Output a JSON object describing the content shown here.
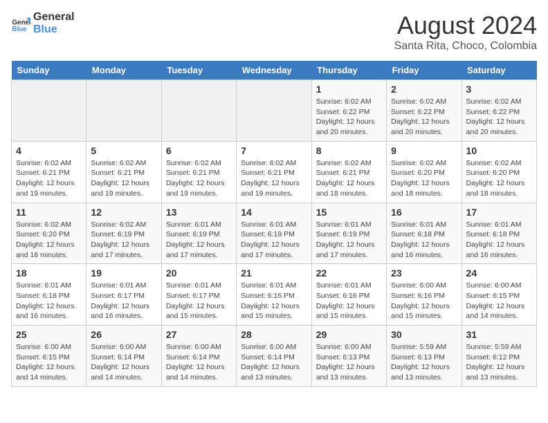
{
  "logo": {
    "line1": "General",
    "line2": "Blue"
  },
  "title": "August 2024",
  "subtitle": "Santa Rita, Choco, Colombia",
  "days_of_week": [
    "Sunday",
    "Monday",
    "Tuesday",
    "Wednesday",
    "Thursday",
    "Friday",
    "Saturday"
  ],
  "weeks": [
    [
      {
        "day": "",
        "info": ""
      },
      {
        "day": "",
        "info": ""
      },
      {
        "day": "",
        "info": ""
      },
      {
        "day": "",
        "info": ""
      },
      {
        "day": "1",
        "info": "Sunrise: 6:02 AM\nSunset: 6:22 PM\nDaylight: 12 hours and 20 minutes."
      },
      {
        "day": "2",
        "info": "Sunrise: 6:02 AM\nSunset: 6:22 PM\nDaylight: 12 hours and 20 minutes."
      },
      {
        "day": "3",
        "info": "Sunrise: 6:02 AM\nSunset: 6:22 PM\nDaylight: 12 hours and 20 minutes."
      }
    ],
    [
      {
        "day": "4",
        "info": "Sunrise: 6:02 AM\nSunset: 6:21 PM\nDaylight: 12 hours and 19 minutes."
      },
      {
        "day": "5",
        "info": "Sunrise: 6:02 AM\nSunset: 6:21 PM\nDaylight: 12 hours and 19 minutes."
      },
      {
        "day": "6",
        "info": "Sunrise: 6:02 AM\nSunset: 6:21 PM\nDaylight: 12 hours and 19 minutes."
      },
      {
        "day": "7",
        "info": "Sunrise: 6:02 AM\nSunset: 6:21 PM\nDaylight: 12 hours and 19 minutes."
      },
      {
        "day": "8",
        "info": "Sunrise: 6:02 AM\nSunset: 6:21 PM\nDaylight: 12 hours and 18 minutes."
      },
      {
        "day": "9",
        "info": "Sunrise: 6:02 AM\nSunset: 6:20 PM\nDaylight: 12 hours and 18 minutes."
      },
      {
        "day": "10",
        "info": "Sunrise: 6:02 AM\nSunset: 6:20 PM\nDaylight: 12 hours and 18 minutes."
      }
    ],
    [
      {
        "day": "11",
        "info": "Sunrise: 6:02 AM\nSunset: 6:20 PM\nDaylight: 12 hours and 18 minutes."
      },
      {
        "day": "12",
        "info": "Sunrise: 6:02 AM\nSunset: 6:19 PM\nDaylight: 12 hours and 17 minutes."
      },
      {
        "day": "13",
        "info": "Sunrise: 6:01 AM\nSunset: 6:19 PM\nDaylight: 12 hours and 17 minutes."
      },
      {
        "day": "14",
        "info": "Sunrise: 6:01 AM\nSunset: 6:19 PM\nDaylight: 12 hours and 17 minutes."
      },
      {
        "day": "15",
        "info": "Sunrise: 6:01 AM\nSunset: 6:19 PM\nDaylight: 12 hours and 17 minutes."
      },
      {
        "day": "16",
        "info": "Sunrise: 6:01 AM\nSunset: 6:18 PM\nDaylight: 12 hours and 16 minutes."
      },
      {
        "day": "17",
        "info": "Sunrise: 6:01 AM\nSunset: 6:18 PM\nDaylight: 12 hours and 16 minutes."
      }
    ],
    [
      {
        "day": "18",
        "info": "Sunrise: 6:01 AM\nSunset: 6:18 PM\nDaylight: 12 hours and 16 minutes."
      },
      {
        "day": "19",
        "info": "Sunrise: 6:01 AM\nSunset: 6:17 PM\nDaylight: 12 hours and 16 minutes."
      },
      {
        "day": "20",
        "info": "Sunrise: 6:01 AM\nSunset: 6:17 PM\nDaylight: 12 hours and 15 minutes."
      },
      {
        "day": "21",
        "info": "Sunrise: 6:01 AM\nSunset: 6:16 PM\nDaylight: 12 hours and 15 minutes."
      },
      {
        "day": "22",
        "info": "Sunrise: 6:01 AM\nSunset: 6:16 PM\nDaylight: 12 hours and 15 minutes."
      },
      {
        "day": "23",
        "info": "Sunrise: 6:00 AM\nSunset: 6:16 PM\nDaylight: 12 hours and 15 minutes."
      },
      {
        "day": "24",
        "info": "Sunrise: 6:00 AM\nSunset: 6:15 PM\nDaylight: 12 hours and 14 minutes."
      }
    ],
    [
      {
        "day": "25",
        "info": "Sunrise: 6:00 AM\nSunset: 6:15 PM\nDaylight: 12 hours and 14 minutes."
      },
      {
        "day": "26",
        "info": "Sunrise: 6:00 AM\nSunset: 6:14 PM\nDaylight: 12 hours and 14 minutes."
      },
      {
        "day": "27",
        "info": "Sunrise: 6:00 AM\nSunset: 6:14 PM\nDaylight: 12 hours and 14 minutes."
      },
      {
        "day": "28",
        "info": "Sunrise: 6:00 AM\nSunset: 6:14 PM\nDaylight: 12 hours and 13 minutes."
      },
      {
        "day": "29",
        "info": "Sunrise: 6:00 AM\nSunset: 6:13 PM\nDaylight: 12 hours and 13 minutes."
      },
      {
        "day": "30",
        "info": "Sunrise: 5:59 AM\nSunset: 6:13 PM\nDaylight: 12 hours and 13 minutes."
      },
      {
        "day": "31",
        "info": "Sunrise: 5:59 AM\nSunset: 6:12 PM\nDaylight: 12 hours and 13 minutes."
      }
    ]
  ]
}
